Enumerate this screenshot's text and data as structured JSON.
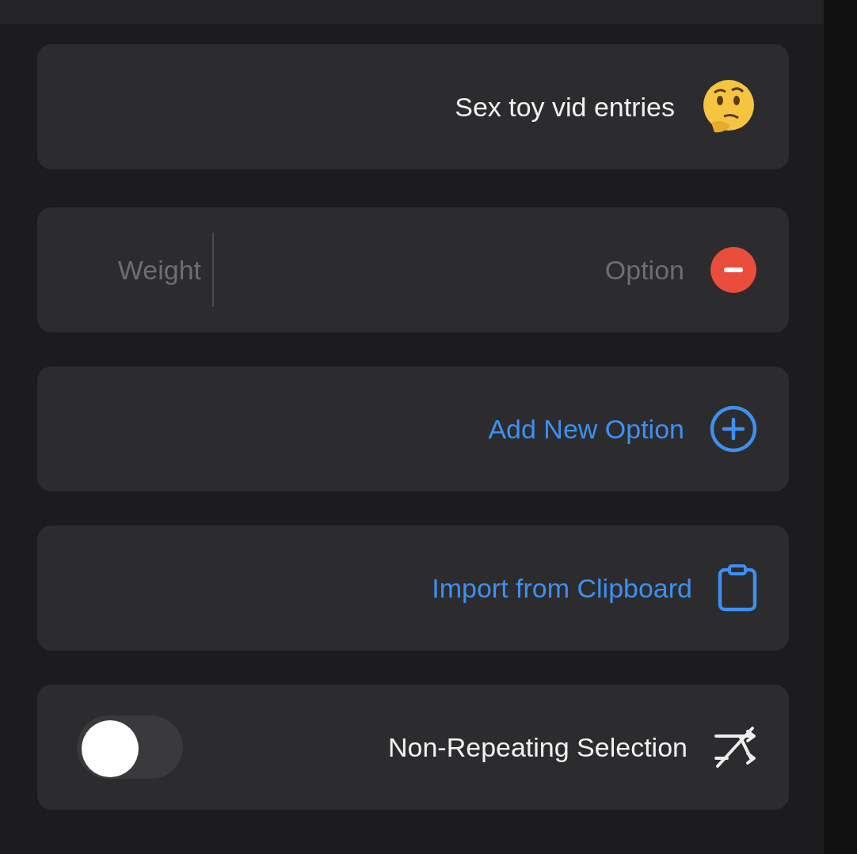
{
  "title": {
    "text": "Sex toy vid entries"
  },
  "options": [
    {
      "option_placeholder": "Option",
      "weight_placeholder": "Weight"
    }
  ],
  "actions": [
    {
      "kind": "add",
      "label": "Add New Option"
    },
    {
      "kind": "import",
      "label": "Import from Clipboard"
    }
  ],
  "settings": [
    {
      "label": "Non-Repeating Selection",
      "on": false
    }
  ]
}
